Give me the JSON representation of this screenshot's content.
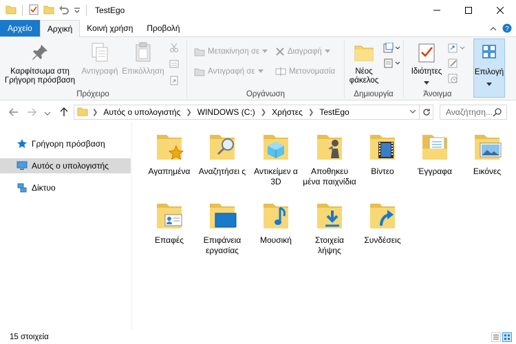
{
  "window": {
    "title": "TestEgo",
    "controls": [
      "minimize",
      "maximize",
      "close"
    ]
  },
  "tabs": [
    {
      "label": "Αρχείο",
      "kind": "file"
    },
    {
      "label": "Αρχική",
      "kind": "active"
    },
    {
      "label": "Κοινή χρήση",
      "kind": "normal"
    },
    {
      "label": "Προβολή",
      "kind": "normal"
    }
  ],
  "ribbon": {
    "clipboard": {
      "label": "Πρόχειρο",
      "pin": "Καρφίτσωμα στη Γρήγορη πρόσβαση",
      "copy": "Αντιγραφή",
      "paste": "Επικόλληση"
    },
    "organize": {
      "label": "Οργάνωση",
      "move_to": "Μετακίνηση σε",
      "copy_to": "Αντιγραφή σε",
      "delete": "Διαγραφή",
      "rename": "Μετονομασία"
    },
    "new": {
      "label": "Δημιουργία",
      "new_folder": "Νέος φάκελος"
    },
    "open": {
      "label": "Άνοιγμα",
      "properties": "Ιδιότητες"
    },
    "select": {
      "label": "Επιλογή"
    }
  },
  "address": {
    "crumbs": [
      "Αυτός ο υπολογιστής",
      "WINDOWS (C:)",
      "Χρήστες",
      "TestEgo"
    ],
    "search_placeholder": "Αναζήτηση..."
  },
  "navpane": {
    "items": [
      {
        "label": "Γρήγορη πρόσβαση",
        "icon": "star-icon"
      },
      {
        "label": "Αυτός ο υπολογιστής",
        "icon": "computer-icon"
      },
      {
        "label": "Δίκτυο",
        "icon": "network-icon"
      }
    ]
  },
  "folders": [
    {
      "label": "Αγαπημένα",
      "icon": "favorites-folder-icon"
    },
    {
      "label": "Αναζητήσει ς",
      "icon": "searches-folder-icon"
    },
    {
      "label": "Αντικείμεν α 3D",
      "icon": "3d-objects-folder-icon"
    },
    {
      "label": "Αποθηκευ μένα παιχνίδια",
      "icon": "saved-games-folder-icon"
    },
    {
      "label": "Βίντεο",
      "icon": "videos-folder-icon"
    },
    {
      "label": "Έγγραφα",
      "icon": "documents-folder-icon"
    },
    {
      "label": "Εικόνες",
      "icon": "pictures-folder-icon"
    },
    {
      "label": "Επαφές",
      "icon": "contacts-folder-icon"
    },
    {
      "label": "Επιφάνεια εργασίας",
      "icon": "desktop-folder-icon"
    },
    {
      "label": "Μουσική",
      "icon": "music-folder-icon"
    },
    {
      "label": "Στοιχεία λήψης",
      "icon": "downloads-folder-icon"
    },
    {
      "label": "Συνδέσεις",
      "icon": "links-folder-icon"
    }
  ],
  "status": {
    "count": "15 στοιχεία"
  },
  "colors": {
    "accent": "#1979ca",
    "folder": "#f5d46a",
    "selection": "#cce4f7"
  }
}
